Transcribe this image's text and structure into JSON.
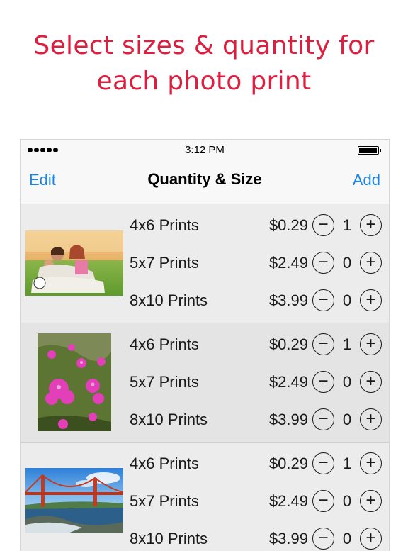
{
  "headline": {
    "line1": "Select sizes & quantity for",
    "line2": "each photo print"
  },
  "status_bar": {
    "time": "3:12 PM",
    "signal_icon": "signal-dots-icon",
    "battery_icon": "battery-icon"
  },
  "nav": {
    "left_label": "Edit",
    "title": "Quantity & Size",
    "right_label": "Add"
  },
  "accent_color": "#dc1f3f",
  "link_color": "#1a84e6",
  "stepper": {
    "minus_label": "−",
    "plus_label": "+"
  },
  "photos": [
    {
      "name": "family-photo",
      "rows": [
        {
          "size": "4x6 Prints",
          "price": "$0.29",
          "qty": "1"
        },
        {
          "size": "5x7 Prints",
          "price": "$2.49",
          "qty": "0"
        },
        {
          "size": "8x10 Prints",
          "price": "$3.99",
          "qty": "0"
        }
      ]
    },
    {
      "name": "flowers-photo",
      "rows": [
        {
          "size": "4x6 Prints",
          "price": "$0.29",
          "qty": "1"
        },
        {
          "size": "5x7 Prints",
          "price": "$2.49",
          "qty": "0"
        },
        {
          "size": "8x10 Prints",
          "price": "$3.99",
          "qty": "0"
        }
      ]
    },
    {
      "name": "golden-gate-photo",
      "rows": [
        {
          "size": "4x6 Prints",
          "price": "$0.29",
          "qty": "1"
        },
        {
          "size": "5x7 Prints",
          "price": "$2.49",
          "qty": "0"
        },
        {
          "size": "8x10 Prints",
          "price": "$3.99",
          "qty": "0"
        }
      ]
    }
  ]
}
